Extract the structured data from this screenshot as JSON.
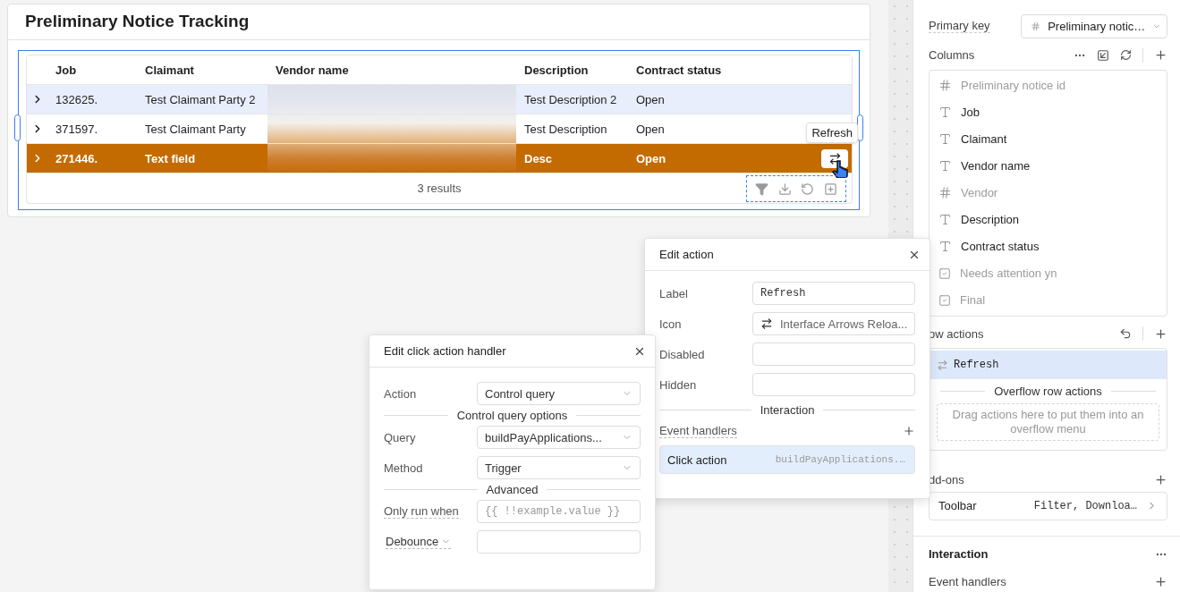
{
  "canvas": {
    "card": {
      "title": "Preliminary Notice Tracking"
    },
    "table": {
      "columns": [
        "Job",
        "Claimant",
        "Vendor name",
        "Description",
        "Contract status"
      ],
      "rows": [
        {
          "job": "132625.",
          "claimant": "Test Claimant Party 2",
          "description": "Test Description 2",
          "contract_status": "Open",
          "highlighted": true,
          "selected": false
        },
        {
          "job": "371597.",
          "claimant": "Test Claimant Party",
          "description": "Test Description",
          "contract_status": "Open",
          "highlighted": false,
          "selected": false
        },
        {
          "job": "271446.",
          "claimant": "Text field",
          "description": "Desc",
          "contract_status": "Open",
          "highlighted": false,
          "selected": true
        }
      ],
      "row_action_tooltip": "Refresh",
      "footer": "3 results"
    }
  },
  "edit_action": {
    "title": "Edit action",
    "fields": [
      {
        "kind": "mono",
        "label": "Label",
        "value": "Refresh"
      },
      {
        "kind": "icon",
        "label": "Icon",
        "value": "Interface Arrows Reloa..."
      },
      {
        "kind": "empty",
        "label": "Disabled"
      },
      {
        "kind": "empty",
        "label": "Hidden"
      }
    ],
    "section": "Interaction",
    "event_handlers_label": "Event handlers",
    "handlers": [
      {
        "name": "Click action",
        "query": "buildPayApplications.…",
        "selected": true
      }
    ]
  },
  "handler_panel": {
    "title": "Edit click action handler",
    "rows": [
      {
        "kind": "select",
        "label": "Action",
        "value": "Control query"
      },
      {
        "kind": "divider",
        "label": "Control query options"
      },
      {
        "kind": "select",
        "label": "Query",
        "value": "buildPayApplications..."
      },
      {
        "kind": "select",
        "label": "Method",
        "value": "Trigger"
      },
      {
        "kind": "divider",
        "label": "Advanced"
      },
      {
        "kind": "code",
        "label": "Only run when",
        "placeholder": "{{ !!example.value }}"
      },
      {
        "kind": "dropdown",
        "label": "Debounce"
      }
    ]
  },
  "inspector": {
    "primary_key": {
      "label": "Primary key",
      "value": "Preliminary notic…"
    },
    "columns": {
      "label": "Columns",
      "items": [
        {
          "name": "Preliminary notice id",
          "kind": "number",
          "hidden": true
        },
        {
          "name": "Job",
          "kind": "text",
          "hidden": false
        },
        {
          "name": "Claimant",
          "kind": "text",
          "hidden": false
        },
        {
          "name": "Vendor name",
          "kind": "text",
          "hidden": false
        },
        {
          "name": "Vendor",
          "kind": "number",
          "hidden": true
        },
        {
          "name": "Description",
          "kind": "text",
          "hidden": false
        },
        {
          "name": "Contract status",
          "kind": "text",
          "hidden": false
        },
        {
          "name": "Needs attention yn",
          "kind": "boolean",
          "hidden": true
        },
        {
          "name": "Final",
          "kind": "boolean",
          "hidden": true
        }
      ]
    },
    "row_actions": {
      "label": "ow actions",
      "items": [
        {
          "label": "Refresh",
          "selected": true
        }
      ],
      "overflow_label": "Overflow row actions",
      "drop_hint": "Drag actions here to put them into an overflow menu"
    },
    "addons": {
      "label": "dd-ons",
      "items": [
        {
          "name": "Toolbar",
          "value": "Filter, Downloa…"
        }
      ]
    },
    "interaction": {
      "title": "Interaction",
      "event_handlers_label": "Event handlers"
    }
  }
}
